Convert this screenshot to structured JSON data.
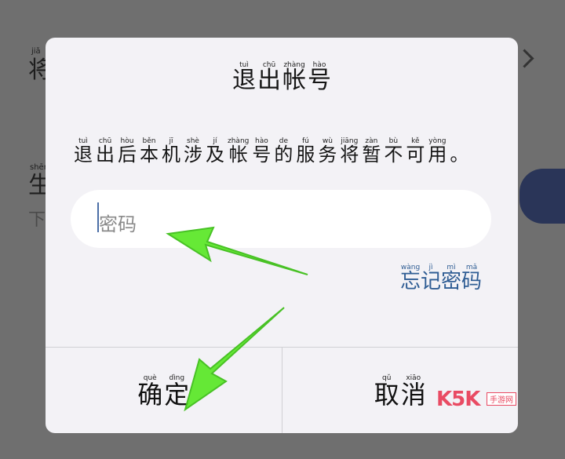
{
  "background": {
    "row1_pinyin": "jiǎ",
    "row1_char": "将",
    "row2_pinyin": "shēn",
    "row2_char": "生",
    "row2_sub": "下"
  },
  "dialog": {
    "title": [
      {
        "py": "tuì",
        "hz": "退"
      },
      {
        "py": "chū",
        "hz": "出"
      },
      {
        "py": "zhàng",
        "hz": "帐"
      },
      {
        "py": "hào",
        "hz": "号"
      }
    ],
    "message": [
      {
        "py": "tuì",
        "hz": "退"
      },
      {
        "py": "chū",
        "hz": "出"
      },
      {
        "py": "hòu",
        "hz": "后"
      },
      {
        "py": "běn",
        "hz": "本"
      },
      {
        "py": "jī",
        "hz": "机"
      },
      {
        "py": "shè",
        "hz": "涉"
      },
      {
        "py": "jí",
        "hz": "及"
      },
      {
        "py": "zhàng",
        "hz": "帐"
      },
      {
        "py": "hào",
        "hz": "号"
      },
      {
        "py": "de",
        "hz": "的"
      },
      {
        "py": "fú",
        "hz": "服"
      },
      {
        "py": "wù",
        "hz": "务"
      },
      {
        "py": "jiāng",
        "hz": "将"
      },
      {
        "py": "zàn",
        "hz": "暂"
      },
      {
        "py": "bù",
        "hz": "不"
      },
      {
        "py": "kě",
        "hz": "可"
      },
      {
        "py": "yòng",
        "hz": "用"
      },
      {
        "py": "",
        "hz": "。"
      }
    ],
    "password_placeholder": "密码",
    "forgot_password": [
      {
        "py": "wàng",
        "hz": "忘"
      },
      {
        "py": "jì",
        "hz": "记"
      },
      {
        "py": "mì",
        "hz": "密"
      },
      {
        "py": "mǎ",
        "hz": "码"
      }
    ],
    "confirm": [
      {
        "py": "què",
        "hz": "确"
      },
      {
        "py": "dìng",
        "hz": "定"
      }
    ],
    "cancel": [
      {
        "py": "qǔ",
        "hz": "取"
      },
      {
        "py": "xiāo",
        "hz": "消"
      }
    ]
  },
  "watermark": {
    "text": "K5K",
    "sub": "手游网"
  },
  "colors": {
    "accent": "#2f5d94",
    "arrow": "#5ee82c",
    "watermark": "#e94b63"
  }
}
